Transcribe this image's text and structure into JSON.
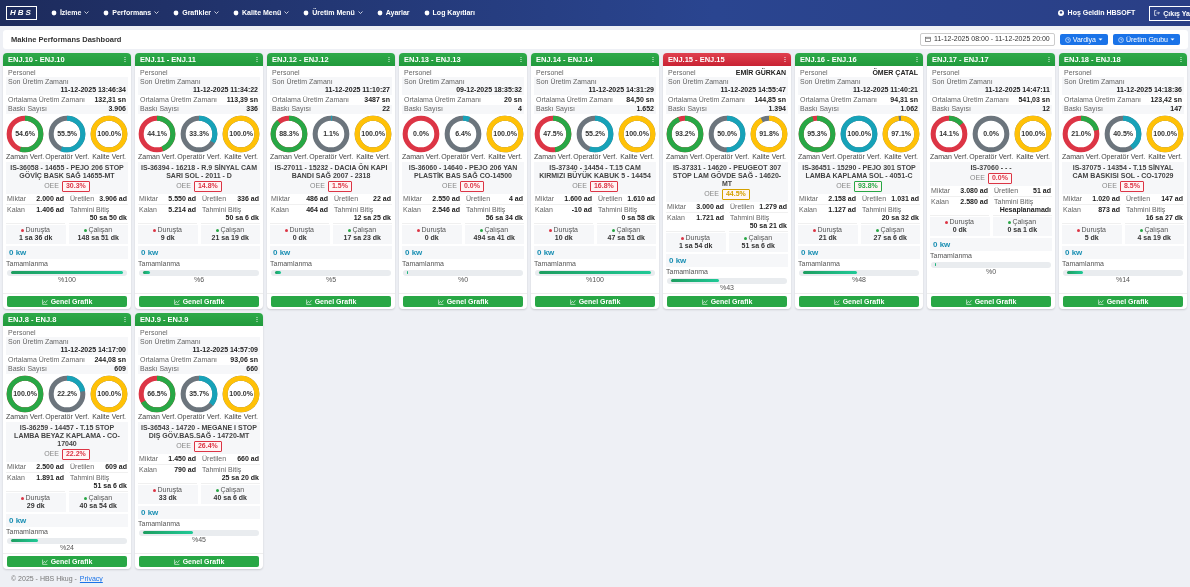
{
  "navbar": {
    "logo": "HBS",
    "items": [
      {
        "label": "İzleme",
        "dropdown": true
      },
      {
        "label": "Performans",
        "dropdown": true
      },
      {
        "label": "Grafikler",
        "dropdown": true
      },
      {
        "label": "Kalite Menü",
        "dropdown": true
      },
      {
        "label": "Üretim Menü",
        "dropdown": true
      },
      {
        "label": "Ayarlar",
        "dropdown": false
      },
      {
        "label": "Log Kayıtları",
        "dropdown": false
      }
    ],
    "greeting": "Hoş Geldin HBSOFT",
    "logout": "Çıkış Ya"
  },
  "header": {
    "title": "Makine Performans Dashboard",
    "date_range": "11-12-2025 08:00 - 11-12-2025 20:00",
    "buttons": [
      "Vardiya",
      "Üretim Grubu"
    ]
  },
  "cards": [
    {
      "title": "ENJ.10 - ENJ.10",
      "alarm": false,
      "info": [
        {
          "label": "Personel"
        },
        {
          "label": "Son Üretim Zamanı",
          "value": "11-12-2025 13:46:34"
        },
        {
          "label": "Ortalama Üretim Zamanı",
          "value": "132,31 sn"
        },
        {
          "label": "Baskı Sayısı",
          "value": "3.906"
        }
      ],
      "gauges": [
        {
          "kind": "time",
          "label": "Zaman Verf.",
          "reading": "54.6%"
        },
        {
          "kind": "operator",
          "label": "Operatör Verf.",
          "reading": "55.5%"
        },
        {
          "kind": "quality",
          "label": "Kalite Verf.",
          "reading": "100.0%"
        }
      ],
      "job": "IS-36058 - 14655 - PEJO 206 STOP GÖVİÇ BASK SAĞ 14655-MT",
      "oee": {
        "label": "OEE",
        "value": "30.3%",
        "color": "#dc3545"
      },
      "stats": [
        {
          "label": "Miktar",
          "value": "2.000 ad"
        },
        {
          "label": "Üretilen",
          "value": "3.906 ad"
        },
        {
          "label": "Kalan",
          "value": "1.406 ad"
        },
        {
          "label": "Tahmini Bitiş",
          "value": "50 sa 50 dk"
        }
      ],
      "states": [
        {
          "kind": "stop",
          "label": "Duruşta",
          "value": "1 sa 36 dk"
        },
        {
          "kind": "run",
          "label": "Çalışan",
          "value": "148 sa 51 dk"
        }
      ],
      "power": "0 kw",
      "progress": {
        "label": "Tamamlanma",
        "level": 1,
        "reading": "%100"
      },
      "button": "Genel Grafik"
    },
    {
      "title": "ENJ.11 - ENJ.11",
      "alarm": false,
      "info": [
        {
          "label": "Personel"
        },
        {
          "label": "Son Üretim Zamanı",
          "value": "11-12-2025 11:34:22"
        },
        {
          "label": "Ortalama Üretim Zamanı",
          "value": "113,39 sn"
        },
        {
          "label": "Baskı Sayısı",
          "value": "336"
        }
      ],
      "gauges": [
        {
          "kind": "time",
          "label": "Zaman Verf.",
          "reading": "44.1%"
        },
        {
          "kind": "operator",
          "label": "Operatör Verf.",
          "reading": "33.3%"
        },
        {
          "kind": "quality",
          "label": "Kalite Verf.",
          "reading": "100.0%"
        }
      ],
      "job": "IS-36394 - 16218 - R.9 SİNYAL CAM SARI SOL - 2011 - D",
      "oee": {
        "label": "OEE",
        "value": "14.8%",
        "color": "#dc3545"
      },
      "stats": [
        {
          "label": "Miktar",
          "value": "5.550 ad"
        },
        {
          "label": "Üretilen",
          "value": "336 ad"
        },
        {
          "label": "Kalan",
          "value": "5.214 ad"
        },
        {
          "label": "Tahmini Bitiş",
          "value": "50 sa 6 dk"
        }
      ],
      "states": [
        {
          "kind": "stop",
          "label": "Duruşta",
          "value": "9 dk"
        },
        {
          "kind": "run",
          "label": "Çalışan",
          "value": "21 sa 19 dk"
        }
      ],
      "power": "0 kw",
      "progress": {
        "label": "Tamamlanma",
        "level": 0.06,
        "reading": "%6"
      },
      "button": "Genel Grafik"
    },
    {
      "title": "ENJ.12 - ENJ.12",
      "alarm": false,
      "info": [
        {
          "label": "Personel"
        },
        {
          "label": "Son Üretim Zamanı",
          "value": "11-12-2025 11:10:27"
        },
        {
          "label": "Ortalama Üretim Zamanı",
          "value": "3487 sn"
        },
        {
          "label": "Baskı Sayısı",
          "value": "22"
        }
      ],
      "gauges": [
        {
          "kind": "time",
          "label": "Zaman Verf.",
          "reading": "88.3%"
        },
        {
          "kind": "operator",
          "label": "Operatör Verf.",
          "reading": "1.1%"
        },
        {
          "kind": "quality",
          "label": "Kalite Verf.",
          "reading": "100.0%"
        }
      ],
      "job": "IS-27011 - 15232 - DACIA ÖN KAPI BANDI SAĞ 2007 - 2318",
      "oee": {
        "label": "OEE",
        "value": "1.5%",
        "color": "#dc3545"
      },
      "stats": [
        {
          "label": "Miktar",
          "value": "486 ad"
        },
        {
          "label": "Üretilen",
          "value": "22 ad"
        },
        {
          "label": "Kalan",
          "value": "464 ad"
        },
        {
          "label": "Tahmini Bitiş",
          "value": "12 sa 25 dk"
        }
      ],
      "states": [
        {
          "kind": "stop",
          "label": "Duruşta",
          "value": "0 dk"
        },
        {
          "kind": "run",
          "label": "Çalışan",
          "value": "17 sa 23 dk"
        }
      ],
      "power": "0 kw",
      "progress": {
        "label": "Tamamlanma",
        "level": 0.05,
        "reading": "%5"
      },
      "button": "Genel Grafik"
    },
    {
      "title": "ENJ.13 - ENJ.13",
      "alarm": false,
      "info": [
        {
          "label": "Personel"
        },
        {
          "label": "Son Üretim Zamanı",
          "value": "09-12-2025 18:35:32"
        },
        {
          "label": "Ortalama Üretim Zamanı",
          "value": "20 sn"
        },
        {
          "label": "Baskı Sayısı",
          "value": "4"
        }
      ],
      "gauges": [
        {
          "kind": "time",
          "label": "Zaman Verf.",
          "reading": "0.0%"
        },
        {
          "kind": "operator",
          "label": "Operatör Verf.",
          "reading": "6.4%"
        },
        {
          "kind": "quality",
          "label": "Kalite Verf.",
          "reading": "100.0%"
        }
      ],
      "job": "IS-36060 - 14640 - PEJO 206 YAN PLASTİK BAS SAĞ CO-14500",
      "oee": {
        "label": "OEE",
        "value": "0.0%",
        "color": "#dc3545"
      },
      "stats": [
        {
          "label": "Miktar",
          "value": "2.550 ad"
        },
        {
          "label": "Üretilen",
          "value": "4 ad"
        },
        {
          "label": "Kalan",
          "value": "2.546 ad"
        },
        {
          "label": "Tahmini Bitiş",
          "value": "56 sa 34 dk"
        }
      ],
      "states": [
        {
          "kind": "stop",
          "label": "Duruşta",
          "value": "0 dk"
        },
        {
          "kind": "run",
          "label": "Çalışan",
          "value": "494 sa 41 dk"
        }
      ],
      "power": "0 kw",
      "progress": {
        "label": "Tamamlanma",
        "level": 0,
        "reading": "%0"
      },
      "button": "Genel Grafik"
    },
    {
      "title": "ENJ.14 - ENJ.14",
      "alarm": false,
      "info": [
        {
          "label": "Personel"
        },
        {
          "label": "Son Üretim Zamanı",
          "value": "11-12-2025 14:31:29"
        },
        {
          "label": "Ortalama Üretim Zamanı",
          "value": "84,50 sn"
        },
        {
          "label": "Baskı Sayısı",
          "value": "1.652"
        }
      ],
      "gauges": [
        {
          "kind": "time",
          "label": "Zaman Verf.",
          "reading": "47.5%"
        },
        {
          "kind": "operator",
          "label": "Operatör Verf.",
          "reading": "55.2%"
        },
        {
          "kind": "quality",
          "label": "Kalite Verf.",
          "reading": "100.0%"
        }
      ],
      "job": "IS-37340 - 14454 - T.15 CAM KIRMIZI BÜYÜK KABUK 5 - 14454",
      "oee": {
        "label": "OEE",
        "value": "16.8%",
        "color": "#dc3545"
      },
      "stats": [
        {
          "label": "Miktar",
          "value": "1.600 ad"
        },
        {
          "label": "Üretilen",
          "value": "1.610 ad"
        },
        {
          "label": "Kalan",
          "value": "-10 ad"
        },
        {
          "label": "Tahmini Bitiş",
          "value": "0 sa 58 dk"
        }
      ],
      "states": [
        {
          "kind": "stop",
          "label": "Duruşta",
          "value": "10 dk"
        },
        {
          "kind": "run",
          "label": "Çalışan",
          "value": "47 sa 51 dk"
        }
      ],
      "power": "0 kw",
      "progress": {
        "label": "Tamamlanma",
        "level": 1,
        "reading": "%100"
      },
      "button": "Genel Grafik"
    },
    {
      "title": "ENJ.15 - ENJ.15",
      "alarm": true,
      "info": [
        {
          "label": "Personel",
          "value": "EMİR GÜRKAN"
        },
        {
          "label": "Son Üretim Zamanı",
          "value": "11-12-2025 14:55:47"
        },
        {
          "label": "Ortalama Üretim Zamanı",
          "value": "144,85 sn"
        },
        {
          "label": "Baskı Sayısı",
          "value": "1.394"
        }
      ],
      "gauges": [
        {
          "kind": "time",
          "label": "Zaman Verf.",
          "reading": "93.2%"
        },
        {
          "kind": "operator",
          "label": "Operatör Verf.",
          "reading": "50.0%"
        },
        {
          "kind": "quality",
          "label": "Kalite Verf.",
          "reading": "91.8%"
        }
      ],
      "job": "IS-37331 - 14620 - PEUGEOT 307 STOP LAM GÖVDE SAĞ - 14620-MT",
      "oee": {
        "label": "OEE",
        "value": "44.5%",
        "color": "#d4a000"
      },
      "stats": [
        {
          "label": "Miktar",
          "value": "3.000 ad"
        },
        {
          "label": "Üretilen",
          "value": "1.279 ad"
        },
        {
          "label": "Kalan",
          "value": "1.721 ad"
        },
        {
          "label": "Tahmini Bitiş",
          "value": "50 sa 21 dk"
        }
      ],
      "states": [
        {
          "kind": "stop",
          "label": "Duruşta",
          "value": "1 sa 54 dk"
        },
        {
          "kind": "run",
          "label": "Çalışan",
          "value": "51 sa 6 dk"
        }
      ],
      "power": "0 kw",
      "progress": {
        "label": "Tamamlanma",
        "level": 0.43,
        "reading": "%43"
      },
      "button": "Genel Grafik"
    },
    {
      "title": "ENJ.16 - ENJ.16",
      "alarm": false,
      "info": [
        {
          "label": "Personel",
          "value": "ÖMER ÇATAL"
        },
        {
          "label": "Son Üretim Zamanı",
          "value": "11-12-2025 11:40:21"
        },
        {
          "label": "Ortalama Üretim Zamanı",
          "value": "94,31 sn"
        },
        {
          "label": "Baskı Sayısı",
          "value": "1.062"
        }
      ],
      "gauges": [
        {
          "kind": "time",
          "label": "Zaman Verf.",
          "reading": "95.3%"
        },
        {
          "kind": "operator",
          "label": "Operatör Verf.",
          "reading": "100.0%"
        },
        {
          "kind": "quality",
          "label": "Kalite Verf.",
          "reading": "97.1%"
        }
      ],
      "job": "IS-36451 - 15290 - PEJO 301 STOP LAMBA KAPLAMA SOL - 4051-C",
      "oee": {
        "label": "OEE",
        "value": "93.8%",
        "color": "#28a745"
      },
      "stats": [
        {
          "label": "Miktar",
          "value": "2.158 ad"
        },
        {
          "label": "Üretilen",
          "value": "1.031 ad"
        },
        {
          "label": "Kalan",
          "value": "1.127 ad"
        },
        {
          "label": "Tahmini Bitiş",
          "value": "20 sa 32 dk"
        }
      ],
      "states": [
        {
          "kind": "stop",
          "label": "Duruşta",
          "value": "21 dk"
        },
        {
          "kind": "run",
          "label": "Çalışan",
          "value": "27 sa 6 dk"
        }
      ],
      "power": "0 kw",
      "progress": {
        "label": "Tamamlanma",
        "level": 0.48,
        "reading": "%48"
      },
      "button": "Genel Grafik"
    },
    {
      "title": "ENJ.17 - ENJ.17",
      "alarm": false,
      "info": [
        {
          "label": "Personel"
        },
        {
          "label": "Son Üretim Zamanı",
          "value": "11-12-2025 14:47:11"
        },
        {
          "label": "Ortalama Üretim Zamanı",
          "value": "541,03 sn"
        },
        {
          "label": "Baskı Sayısı",
          "value": "12"
        }
      ],
      "gauges": [
        {
          "kind": "time",
          "label": "Zaman Verf.",
          "reading": "14.1%"
        },
        {
          "kind": "operator",
          "label": "Operatör Verf.",
          "reading": "0.0%"
        },
        {
          "kind": "quality",
          "label": "Kalite Verf.",
          "reading": "100.0%"
        }
      ],
      "job": "IS-37060 - - -",
      "oee": {
        "label": "OEE",
        "value": "0.0%",
        "color": "#dc3545"
      },
      "stats": [
        {
          "label": "Miktar",
          "value": "3.080 ad"
        },
        {
          "label": "Üretilen",
          "value": "51 ad"
        },
        {
          "label": "Kalan",
          "value": "2.580 ad"
        },
        {
          "label": "Tahmini Bitiş",
          "value": "Hesaplanamadı"
        }
      ],
      "states": [
        {
          "kind": "stop",
          "label": "Duruşta",
          "value": "0 dk"
        },
        {
          "kind": "run",
          "label": "Çalışan",
          "value": "0 sa 1 dk"
        }
      ],
      "power": "0 kw",
      "progress": {
        "label": "Tamamlanma",
        "level": 0,
        "reading": "%0"
      },
      "button": "Genel Grafik"
    },
    {
      "title": "ENJ.18 - ENJ.18",
      "alarm": false,
      "info": [
        {
          "label": "Personel"
        },
        {
          "label": "Son Üretim Zamanı",
          "value": "11-12-2025 14:18:36"
        },
        {
          "label": "Ortalama Üretim Zamanı",
          "value": "123,42 sn"
        },
        {
          "label": "Baskı Sayısı",
          "value": "147"
        }
      ],
      "gauges": [
        {
          "kind": "time",
          "label": "Zaman Verf.",
          "reading": "21.0%"
        },
        {
          "kind": "operator",
          "label": "Operatör Verf.",
          "reading": "40.5%"
        },
        {
          "kind": "quality",
          "label": "Kalite Verf.",
          "reading": "100.0%"
        }
      ],
      "job": "IS-37075 - 14354 - T.15 SİNYAL CAM BASKISI SOL - CO-17029",
      "oee": {
        "label": "OEE",
        "value": "8.5%",
        "color": "#dc3545"
      },
      "stats": [
        {
          "label": "Miktar",
          "value": "1.020 ad"
        },
        {
          "label": "Üretilen",
          "value": "147 ad"
        },
        {
          "label": "Kalan",
          "value": "873 ad"
        },
        {
          "label": "Tahmini Bitiş",
          "value": "16 sa 27 dk"
        }
      ],
      "states": [
        {
          "kind": "stop",
          "label": "Duruşta",
          "value": "5 dk"
        },
        {
          "kind": "run",
          "label": "Çalışan",
          "value": "4 sa 19 dk"
        }
      ],
      "power": "0 kw",
      "progress": {
        "label": "Tamamlanma",
        "level": 0.14,
        "reading": "%14"
      },
      "button": "Genel Grafik"
    },
    {
      "title": "ENJ.8 - ENJ.8",
      "alarm": false,
      "info": [
        {
          "label": "Personel"
        },
        {
          "label": "Son Üretim Zamanı",
          "value": "11-12-2025 14:17:00"
        },
        {
          "label": "Ortalama Üretim Zamanı",
          "value": "244,08 sn"
        },
        {
          "label": "Baskı Sayısı",
          "value": "609"
        }
      ],
      "gauges": [
        {
          "kind": "time",
          "label": "Zaman Verf.",
          "reading": "100.0%"
        },
        {
          "kind": "operator",
          "label": "Operatör Verf.",
          "reading": "22.2%"
        },
        {
          "kind": "quality",
          "label": "Kalite Verf.",
          "reading": "100.0%"
        }
      ],
      "job": "IS-36259 - 14457 - T.15 STOP LAMBA BEYAZ KAPLAMA - CO-17040",
      "oee": {
        "label": "OEE",
        "value": "22.2%",
        "color": "#dc3545"
      },
      "stats": [
        {
          "label": "Miktar",
          "value": "2.500 ad"
        },
        {
          "label": "Üretilen",
          "value": "609 ad"
        },
        {
          "label": "Kalan",
          "value": "1.891 ad"
        },
        {
          "label": "Tahmini Bitiş",
          "value": "51 sa 6 dk"
        }
      ],
      "states": [
        {
          "kind": "stop",
          "label": "Duruşta",
          "value": "29 dk"
        },
        {
          "kind": "run",
          "label": "Çalışan",
          "value": "40 sa 54 dk"
        }
      ],
      "power": "0 kw",
      "progress": {
        "label": "Tamamlanma",
        "level": 0.24,
        "reading": "%24"
      },
      "button": "Genel Grafik"
    },
    {
      "title": "ENJ.9 - ENJ.9",
      "alarm": false,
      "info": [
        {
          "label": "Personel"
        },
        {
          "label": "Son Üretim Zamanı",
          "value": "11-12-2025 14:57:09"
        },
        {
          "label": "Ortalama Üretim Zamanı",
          "value": "93,06 sn"
        },
        {
          "label": "Baskı Sayısı",
          "value": "660"
        }
      ],
      "gauges": [
        {
          "kind": "time",
          "label": "Zaman Verf.",
          "reading": "66.5%"
        },
        {
          "kind": "operator",
          "label": "Operatör Verf.",
          "reading": "35.7%"
        },
        {
          "kind": "quality",
          "label": "Kalite Verf.",
          "reading": "100.0%"
        }
      ],
      "job": "IS-36543 - 14720 - MEGANE I STOP DIŞ GÖV.BAS.SAĞ - 14720-MT",
      "oee": {
        "label": "OEE",
        "value": "26.4%",
        "color": "#dc3545"
      },
      "stats": [
        {
          "label": "Miktar",
          "value": "1.450 ad"
        },
        {
          "label": "Üretilen",
          "value": "660 ad"
        },
        {
          "label": "Kalan",
          "value": "790 ad"
        },
        {
          "label": "Tahmini Bitiş",
          "value": "25 sa 20 dk"
        }
      ],
      "states": [
        {
          "kind": "stop",
          "label": "Duruşta",
          "value": "33 dk"
        },
        {
          "kind": "run",
          "label": "Çalışan",
          "value": "40 sa 6 dk"
        }
      ],
      "power": "0 kw",
      "progress": {
        "label": "Tamamlanma",
        "level": 0.45,
        "reading": "%45"
      },
      "button": "Genel Grafik"
    }
  ],
  "footer": {
    "text": "© 2025 - HBS Hkug -",
    "link": "Privacy"
  }
}
